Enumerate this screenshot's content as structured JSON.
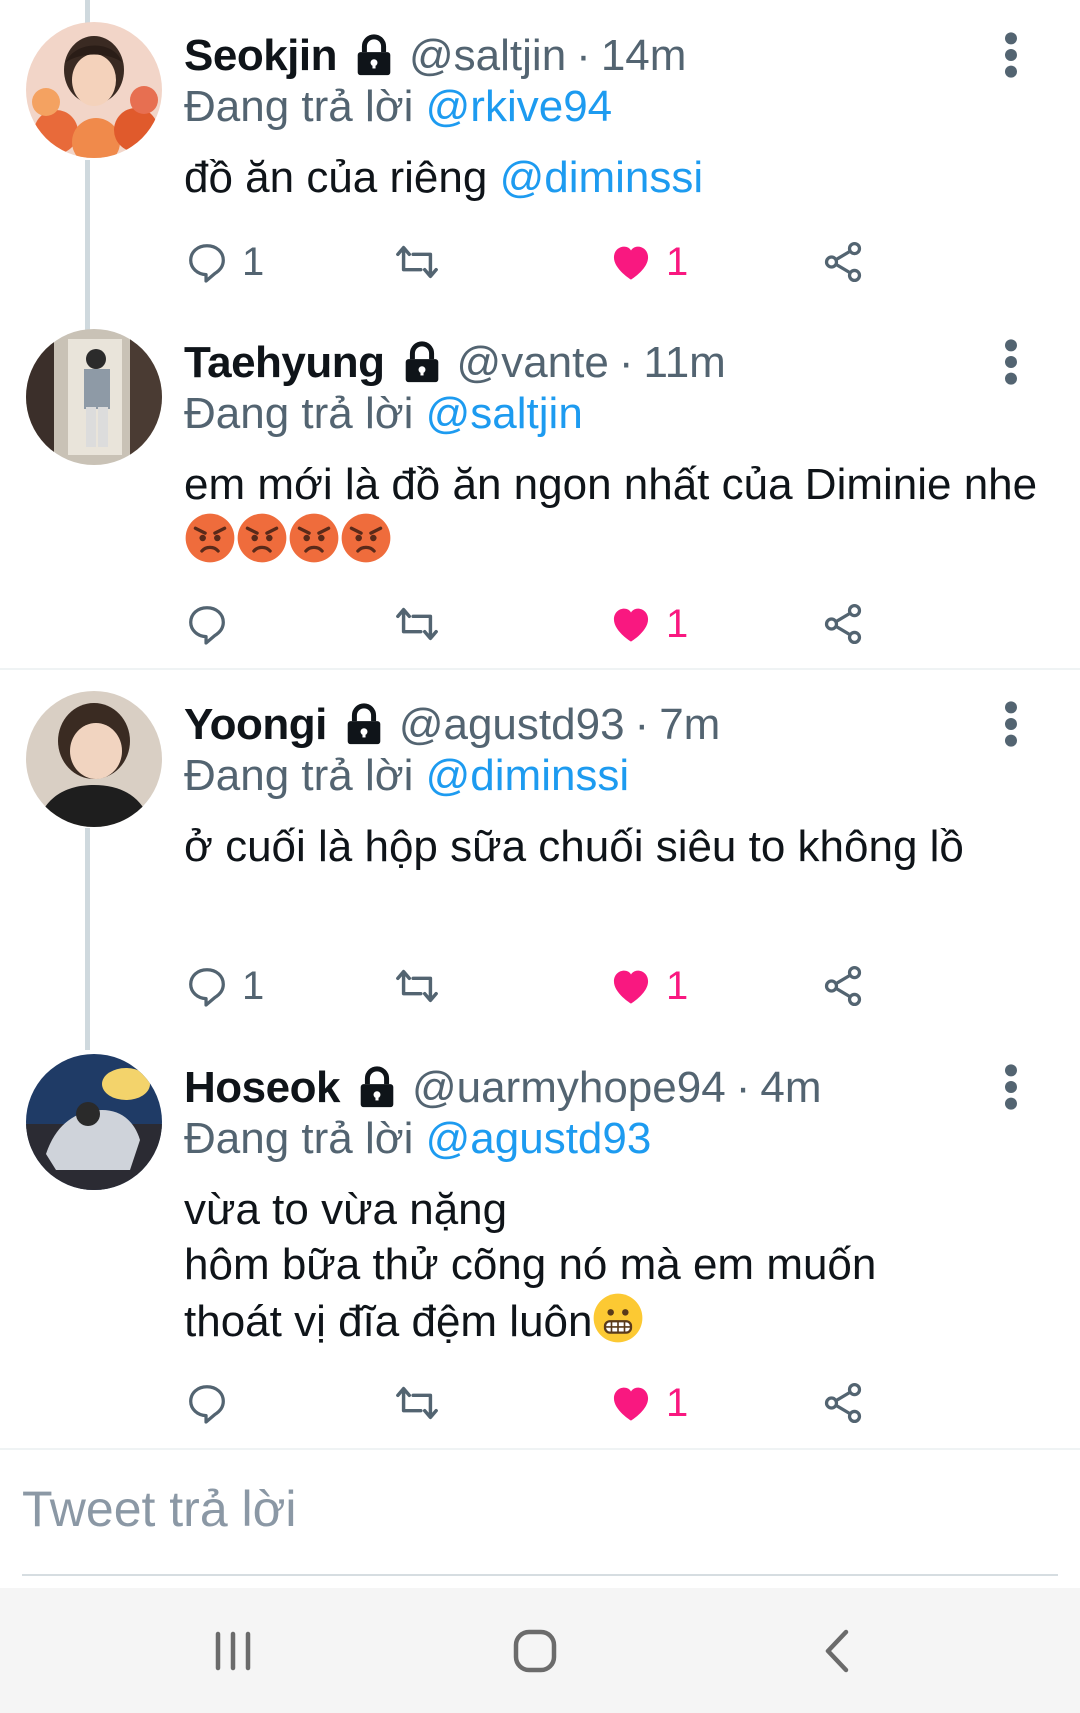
{
  "tweets": [
    {
      "name": "Seokjin",
      "handle": "@saltjin",
      "time": "14m",
      "reply_prefix": "Đang trả lời",
      "reply_to": "@rkive94",
      "text": "đồ ăn của riêng ",
      "mention": "@diminssi",
      "replies": "1",
      "retweets": "",
      "likes": "1"
    },
    {
      "name": "Taehyung",
      "handle": "@vante",
      "time": "11m",
      "reply_prefix": "Đang trả lời",
      "reply_to": "@saltjin",
      "text": "em mới là đồ ăn ngon nhất của Diminie nhe",
      "replies": "",
      "retweets": "",
      "likes": "1"
    },
    {
      "name": "Yoongi",
      "handle": "@agustd93",
      "time": "7m",
      "reply_prefix": "Đang trả lời",
      "reply_to": "@diminssi",
      "text": "ở cuối là hộp sữa chuối siêu to không lồ",
      "replies": "1",
      "retweets": "",
      "likes": "1"
    },
    {
      "name": "Hoseok",
      "handle": "@uarmyhope94",
      "time": "4m",
      "reply_prefix": "Đang trả lời",
      "reply_to": "@agustd93",
      "line1": "vừa to vừa nặng",
      "line2": "hôm bữa thử cõng nó mà em muốn",
      "line3": "thoát vị đĩa đệm luôn",
      "replies": "",
      "retweets": "",
      "likes": "1"
    }
  ],
  "separator": "·",
  "composer": {
    "placeholder": "Tweet trả lời"
  },
  "icons": {
    "lock": "lock-icon",
    "more": "more-vertical-icon",
    "reply": "reply-icon",
    "retweet": "retweet-icon",
    "like": "heart-filled-icon",
    "share": "share-icon",
    "emoji_angry": "angry-face-emoji",
    "emoji_grimace": "grimacing-face-emoji"
  },
  "colors": {
    "mention": "#1d9bf0",
    "like": "#f91880",
    "text": "#0f1419",
    "muted": "#536471"
  }
}
